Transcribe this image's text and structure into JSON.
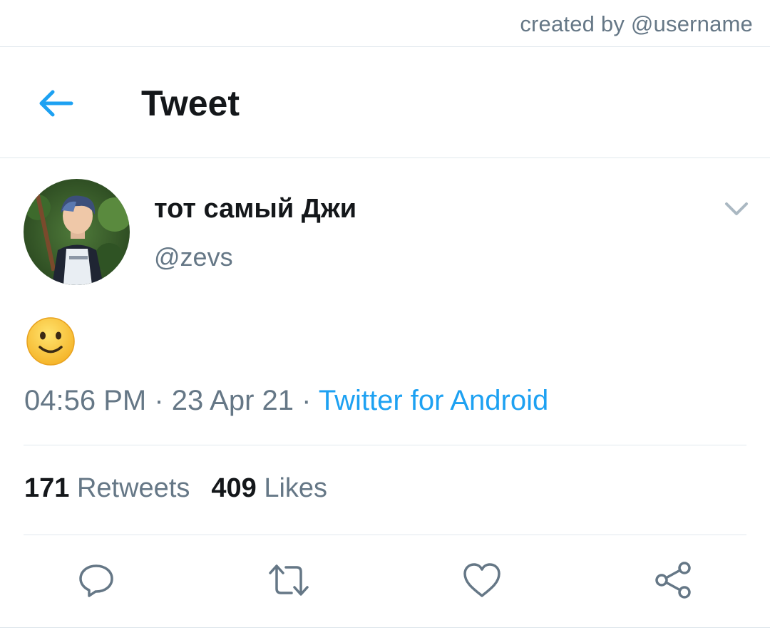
{
  "credit": "created by @username",
  "header": {
    "title": "Tweet",
    "back_icon": "arrow-left-icon"
  },
  "tweet": {
    "display_name": "тот самый Джи",
    "handle": "@zevs",
    "body_emoji": "🙂",
    "time": "04:56 PM",
    "date": "23 Apr 21",
    "source": "Twitter for Android",
    "separator": " · "
  },
  "stats": {
    "retweets_count": "171",
    "retweets_label": "Retweets",
    "likes_count": "409",
    "likes_label": "Likes"
  },
  "actions": [
    "reply-icon",
    "retweet-icon",
    "like-icon",
    "share-icon"
  ],
  "colors": {
    "accent": "#1da1f2",
    "secondary_text": "#657786",
    "primary_text": "#14171a",
    "divider": "#e1e8ed"
  }
}
